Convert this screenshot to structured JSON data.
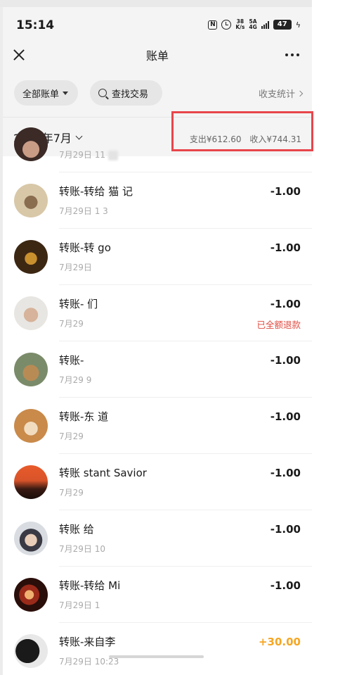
{
  "status_bar": {
    "time": "15:14",
    "speed_top": "38",
    "speed_bottom": "K/s",
    "net_top": "5A",
    "net_bottom": "4G",
    "battery": "47"
  },
  "nav": {
    "title": "账单"
  },
  "filters": {
    "all_bills": "全部账单",
    "search": "查找交易",
    "stats": "收支统计"
  },
  "month": {
    "label": "2026年7月",
    "expense": "支出¥612.60",
    "income": "收入¥744.31"
  },
  "transactions": [
    {
      "title": "",
      "time": "7月29日 11",
      "amount": "",
      "note": ""
    },
    {
      "title": "转账-转给 猫 记",
      "time": "7月29日 1 3",
      "amount": "-1.00",
      "note": ""
    },
    {
      "title": "转账-转 go",
      "time": "7月29日",
      "amount": "-1.00",
      "note": ""
    },
    {
      "title": "转账- 们",
      "time": "7月29",
      "amount": "-1.00",
      "note": "已全额退款"
    },
    {
      "title": "转账- ",
      "time": "7月29 9",
      "amount": "-1.00",
      "note": ""
    },
    {
      "title": "转账-东 道",
      "time": "7月29",
      "amount": "-1.00",
      "note": ""
    },
    {
      "title": "转账 stant Savior",
      "time": "7月29",
      "amount": "-1.00",
      "note": ""
    },
    {
      "title": "转账 给",
      "time": "7月29日 10",
      "amount": "-1.00",
      "note": ""
    },
    {
      "title": "转账-转给 Mi",
      "time": "7月29日 1",
      "amount": "-1.00",
      "note": ""
    },
    {
      "title": "转账-来自李",
      "time": "7月29日 10:23",
      "amount": "+30.00",
      "note": ""
    }
  ],
  "colors": {
    "accent_red": "#e04a3f",
    "income_orange": "#f5a623",
    "highlight_box": "#e8454b"
  }
}
